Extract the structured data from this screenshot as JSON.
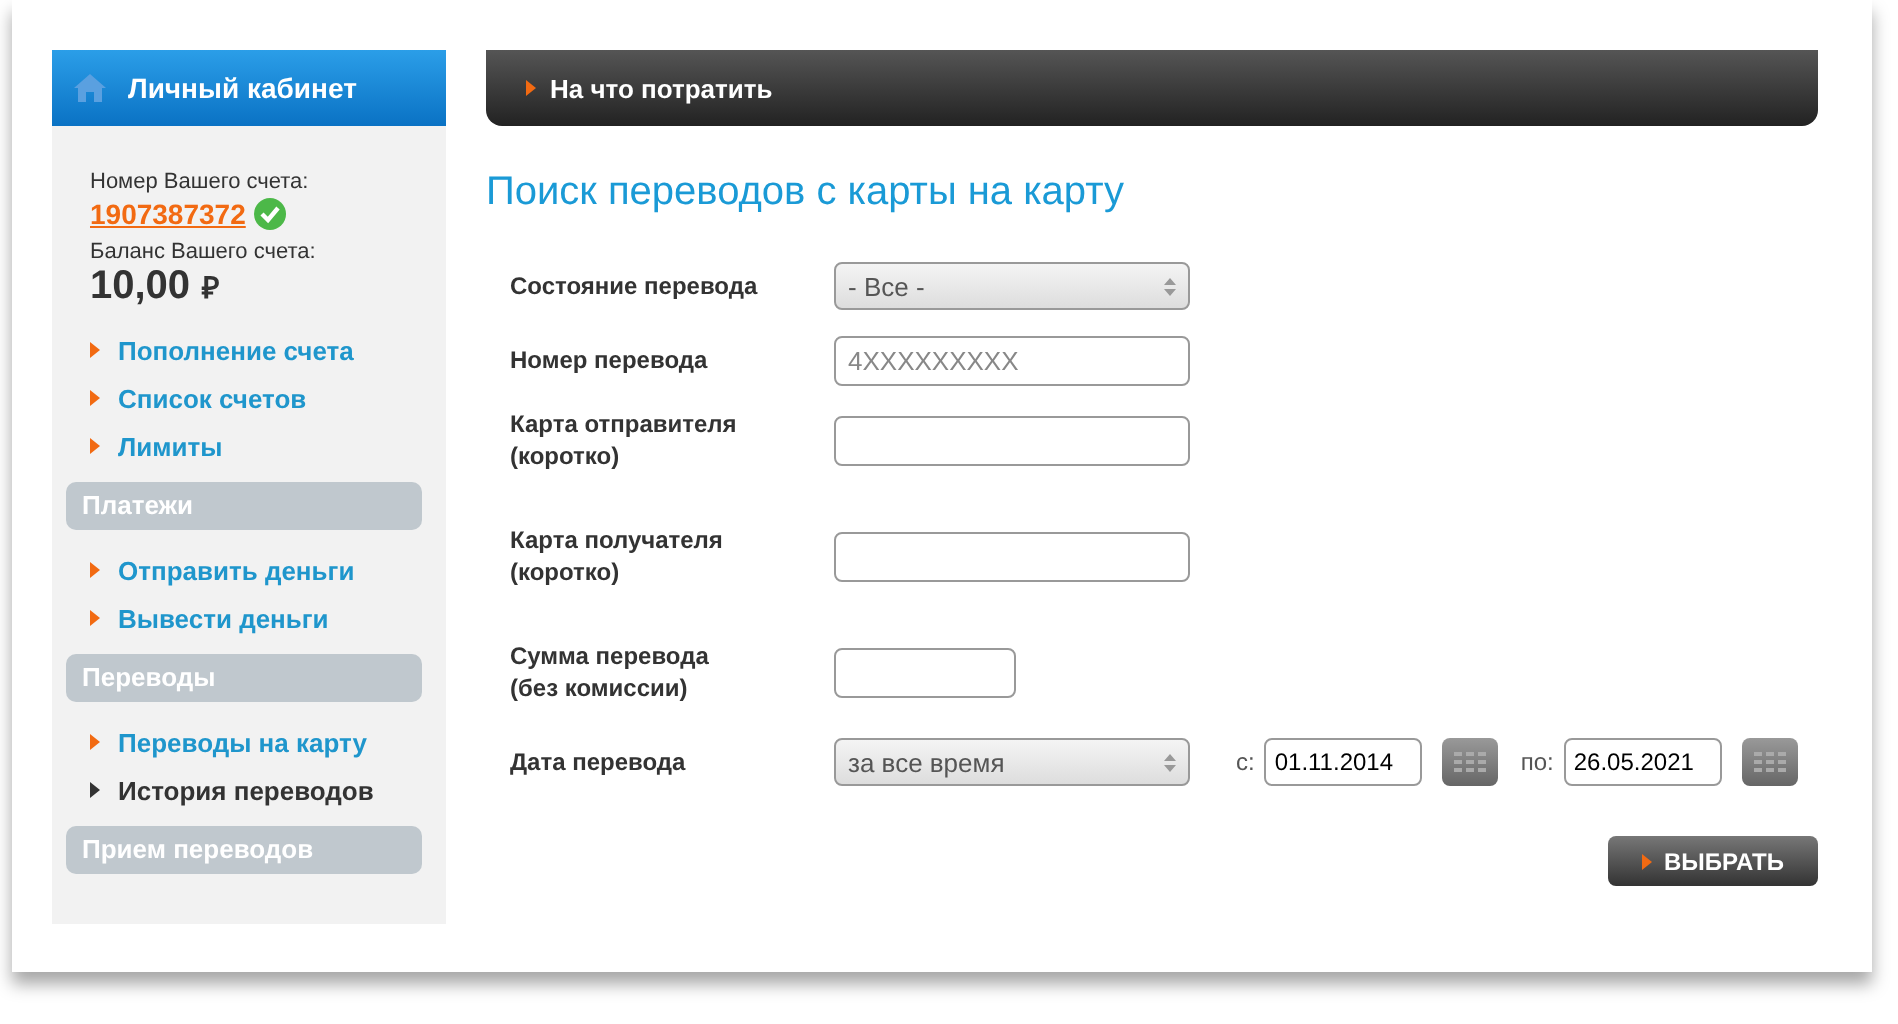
{
  "sidebar": {
    "title": "Личный кабинет",
    "account_label": "Номер Вашего счета:",
    "account_number": "1907387372",
    "balance_label": "Баланс Вашего счета:",
    "balance": "10,00",
    "currency": "₽",
    "groups": [
      {
        "items": [
          {
            "label": "Пополнение счета",
            "selected": false
          },
          {
            "label": "Список счетов",
            "selected": false
          },
          {
            "label": "Лимиты",
            "selected": false
          }
        ]
      },
      {
        "title": "Платежи",
        "items": [
          {
            "label": "Отправить деньги",
            "selected": false
          },
          {
            "label": "Вывести деньги",
            "selected": false
          }
        ]
      },
      {
        "title": "Переводы",
        "items": [
          {
            "label": "Переводы на карту",
            "selected": false
          },
          {
            "label": "История переводов",
            "selected": true
          }
        ]
      },
      {
        "title": "Прием переводов"
      }
    ]
  },
  "top_bar": {
    "label": "На что потратить"
  },
  "page_title": "Поиск переводов с карты на карту",
  "form": [
    {
      "kind": "select",
      "label": "Состояние перевода",
      "value": "- Все -"
    },
    {
      "kind": "text",
      "label": "Номер перевода",
      "placeholder": "4XXXXXXXXX"
    },
    {
      "kind": "text",
      "label": "Карта отправителя\n(коротко)"
    },
    {
      "kind": "text",
      "label": "Карта получателя\n(коротко)"
    },
    {
      "kind": "amount",
      "label": "Сумма перевода\n(без комиссии)"
    },
    {
      "kind": "daterange",
      "label": "Дата перевода",
      "value": "за все время",
      "from_label": "с:",
      "from": "01.11.2014",
      "to_label": "по:",
      "to": "26.05.2021"
    }
  ],
  "submit": "ВЫБРАТЬ"
}
